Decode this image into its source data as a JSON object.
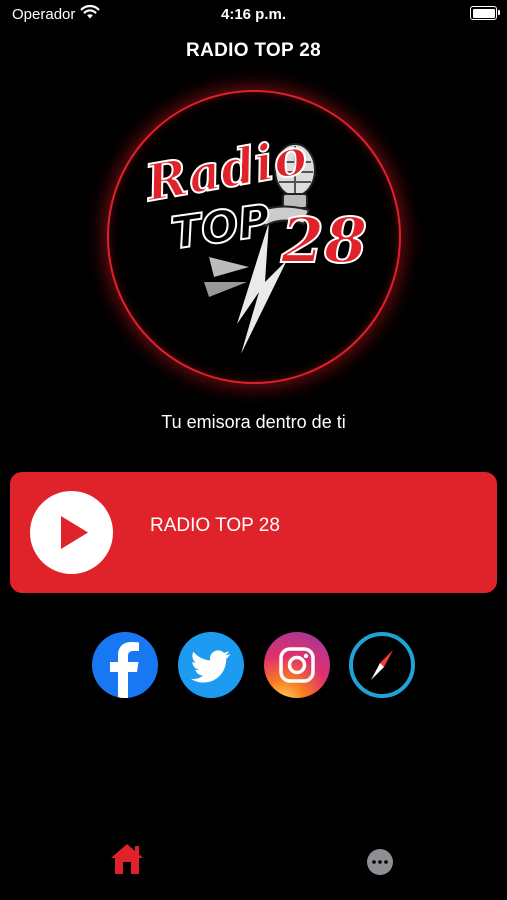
{
  "status_bar": {
    "carrier": "Operador",
    "time": "4:16 p.m.",
    "battery_level": 1.0,
    "wifi_icon": "wifi-icon",
    "battery_icon": "battery-icon"
  },
  "header": {
    "title": "RADIO TOP 28"
  },
  "logo": {
    "icon": "radio-top-28-logo",
    "text_line1": "Radio",
    "text_line2": "TOP",
    "text_line3": "28",
    "ring_color": "#e0202a"
  },
  "tagline": "Tu emisora dentro de ti",
  "player": {
    "station_name": "RADIO TOP 28",
    "play_icon": "play-icon",
    "card_color": "#e0232a"
  },
  "social": [
    {
      "name": "facebook",
      "icon": "facebook-icon",
      "color": "#1877f2"
    },
    {
      "name": "twitter",
      "icon": "twitter-icon",
      "color": "#1d9bf0"
    },
    {
      "name": "instagram",
      "icon": "instagram-icon",
      "color": "#e1306c"
    },
    {
      "name": "website",
      "icon": "compass-icon",
      "color": "#1fa3d6"
    }
  ],
  "tab_bar": {
    "items": [
      {
        "name": "home",
        "icon": "home-icon",
        "active": true,
        "color": "#e0232a"
      },
      {
        "name": "more",
        "icon": "more-icon",
        "active": false,
        "color": "#8e8e93"
      }
    ]
  }
}
